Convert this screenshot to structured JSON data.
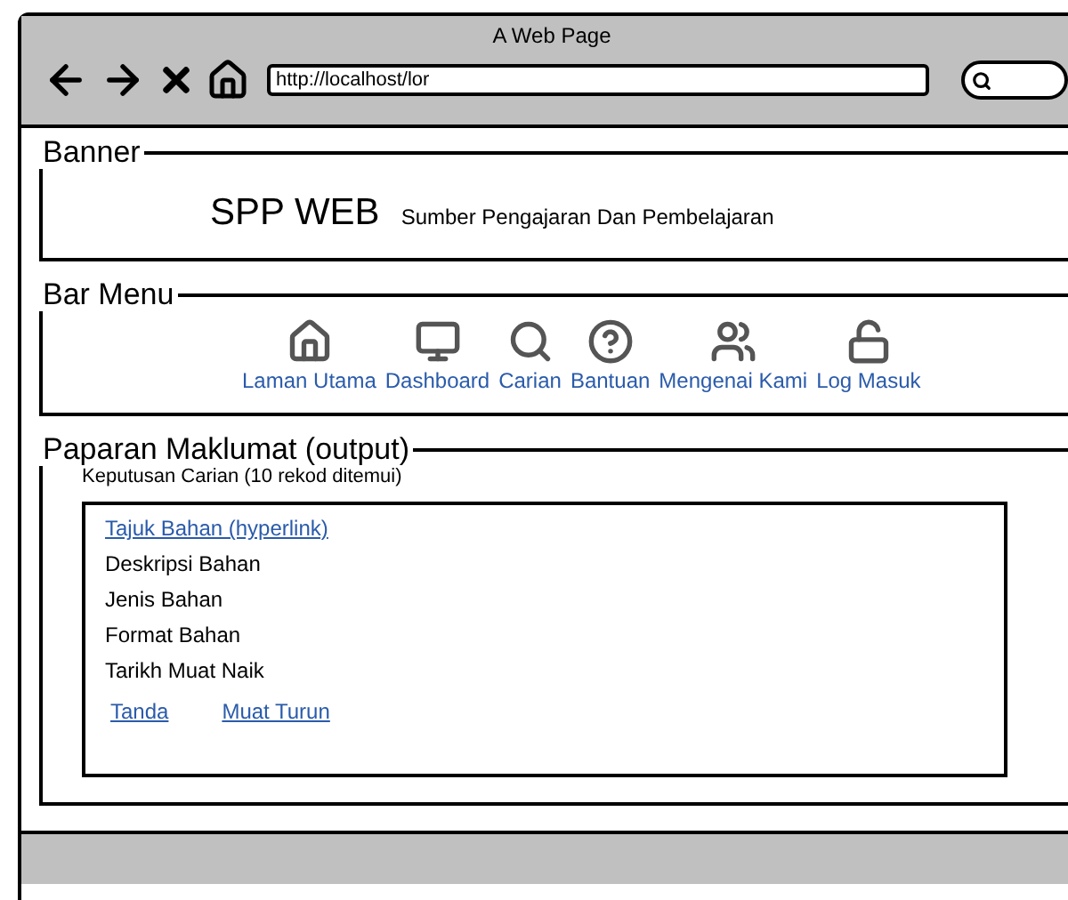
{
  "window": {
    "title": "A Web Page",
    "url": "http://localhost/lor"
  },
  "banner": {
    "legend": "Banner",
    "title": "SPP WEB",
    "subtitle": "Sumber Pengajaran Dan Pembelajaran"
  },
  "menu": {
    "legend": "Bar Menu",
    "items": [
      {
        "label": "Laman Utama"
      },
      {
        "label": "Dashboard"
      },
      {
        "label": "Carian"
      },
      {
        "label": "Bantuan"
      },
      {
        "label": "Mengenai Kami"
      },
      {
        "label": "Log Masuk"
      }
    ]
  },
  "output": {
    "legend": "Paparan Maklumat (output)",
    "summary": "Keputusan Carian (10 rekod ditemui)",
    "fields": [
      {
        "kind": "link",
        "text": "Tajuk Bahan (hyperlink)"
      },
      {
        "kind": "text",
        "text": "Deskripsi Bahan"
      },
      {
        "kind": "text",
        "text": "Jenis Bahan"
      },
      {
        "kind": "text",
        "text": "Format Bahan"
      },
      {
        "kind": "text",
        "text": "Tarikh Muat Naik"
      }
    ],
    "actions": [
      "Tanda",
      "Muat Turun"
    ]
  }
}
